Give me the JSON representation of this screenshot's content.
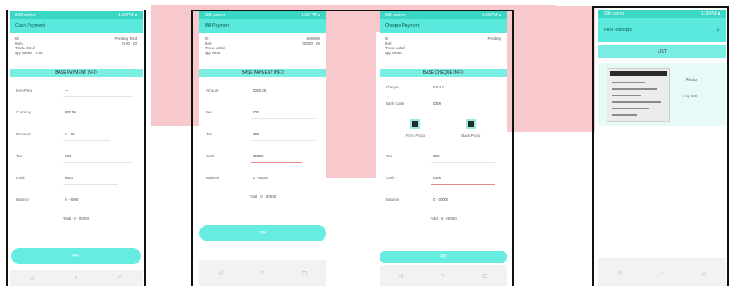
{
  "colors": {
    "accent": "#5ae9dc",
    "status": "#3ad7c4",
    "button": "#66ece0",
    "overlay": "#f7c9cc"
  },
  "screens": [
    {
      "status_left": "SIM carrier",
      "status_right": "1:00 PM ■",
      "title": "Cash Payment",
      "info": [
        "ID",
        "Item",
        "Trade detail",
        "Qty 00000 · 0.00"
      ],
      "info_right": [
        "Pending Tend",
        "0.00 · 00"
      ],
      "section": "BASE PAYMENT INFO",
      "fields": [
        {
          "label": "Item Price",
          "value": "—"
        },
        {
          "label": "Currency",
          "value": "000.00"
        },
        {
          "label": "Discount",
          "value": "0 · 00"
        },
        {
          "label": "Tax",
          "value": "000"
        },
        {
          "label": "Cash",
          "value": "0000"
        },
        {
          "label": "Balance",
          "value": "0 · 0000"
        }
      ],
      "total": "Total · 0 · 00000",
      "button": "PAY",
      "nav": [
        "◁",
        "○",
        "▢"
      ]
    },
    {
      "status_left": "SIM carrier",
      "status_right": "1:00 PM ■",
      "title": "Bill Payment",
      "info": [
        "ID",
        "Item",
        "Trade detail",
        "Qty 0000"
      ],
      "info_right": [
        "0000000",
        "00000 · 00"
      ],
      "section": "BASE PAYMENT INFO",
      "fields": [
        {
          "label": "Amount",
          "value": "0000.00"
        },
        {
          "label": "Fee",
          "value": "000"
        },
        {
          "label": "Tax",
          "value": "000"
        },
        {
          "label": "Cash",
          "value": "00000"
        },
        {
          "label": "Balance",
          "value": "0 · 00000"
        }
      ],
      "total": "Total · 0 · 00000",
      "button": "PAY",
      "nav": [
        "◁",
        "○",
        "▢"
      ]
    },
    {
      "status_left": "SIM carrier",
      "status_right": "1:00 PM ■",
      "title": "Cheque Payment",
      "info": [
        "ID",
        "Item",
        "Trade detail",
        "Qty 00000"
      ],
      "info_right": [
        "Pending"
      ],
      "section": "BASE CHEQUE INFO",
      "fields": [
        {
          "label": "Cheque",
          "value": "0 0 0 0"
        },
        {
          "label": "Bank Code",
          "value": "0000"
        }
      ],
      "photos": [
        "Front Photo",
        "Back Photo"
      ],
      "fields2": [
        {
          "label": "Tax",
          "value": "000"
        },
        {
          "label": "Cash",
          "value": "0000"
        },
        {
          "label": "Balance",
          "value": "0 · 00000"
        }
      ],
      "total": "Total · 0 · 00000",
      "button": "PAY",
      "nav": [
        "◁",
        "○",
        "▢"
      ]
    },
    {
      "status_left": "SIM carrier",
      "status_right": "1:00 PM ■",
      "title": "Past Receipts",
      "search_icon": "⌕",
      "section": "LIST",
      "item_title": "Photo",
      "item_sub": "0 kg 000",
      "nav": [
        "◁",
        "○",
        "▢"
      ]
    }
  ]
}
